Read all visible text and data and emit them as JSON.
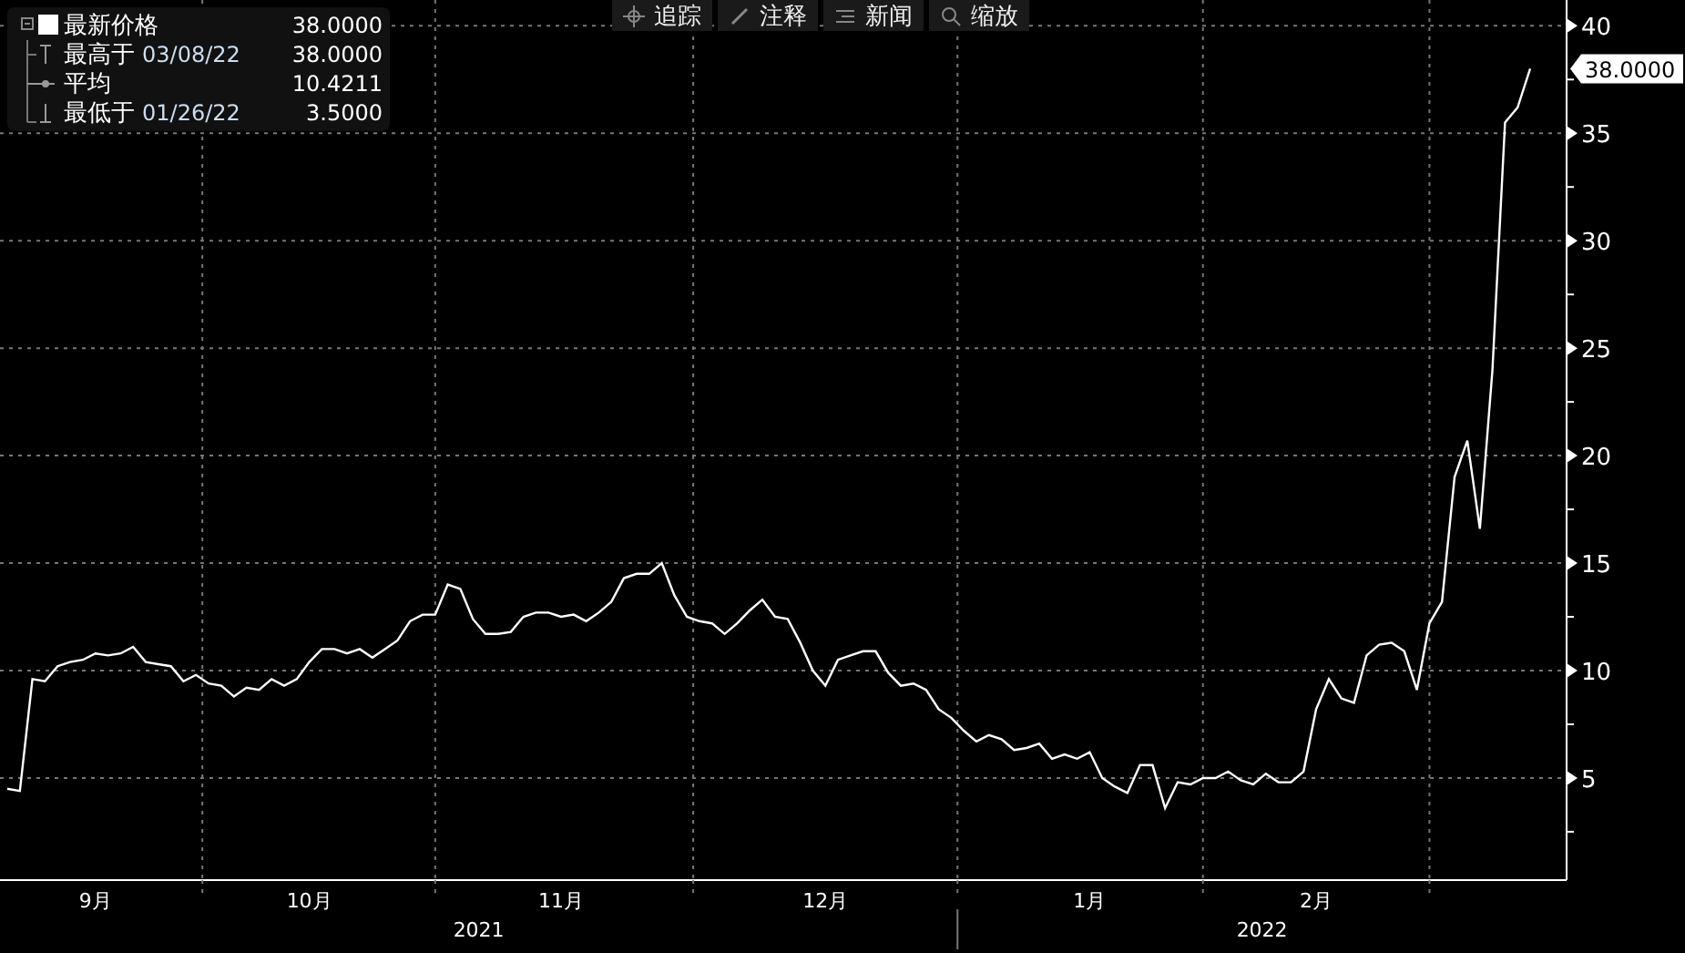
{
  "legend": [
    {
      "kind": "last",
      "value": "38.0000"
    },
    {
      "kind": "high",
      "label": "最高于",
      "date": "03/08/22",
      "value": "38.0000"
    },
    {
      "kind": "average",
      "label": "平均",
      "value": "10.4211"
    },
    {
      "kind": "low",
      "label": "最低于",
      "date": "01/26/22",
      "value": "3.5000"
    }
  ],
  "toolbar": [
    {
      "kind": "track",
      "label": "追踪"
    },
    {
      "kind": "annotate",
      "label": "注释"
    },
    {
      "kind": "news",
      "label": "新闻"
    },
    {
      "kind": "zoom",
      "label": "缩放"
    }
  ],
  "chart": {
    "last_value_label": "38.0000",
    "chart_data": {
      "type": "line",
      "grid": true,
      "ylim": [
        0.25,
        41.2
      ],
      "categories": [
        null,
        null,
        null,
        null,
        null,
        null,
        null,
        "9月",
        null,
        null,
        null,
        null,
        null,
        null,
        null,
        null,
        null,
        null,
        null,
        null,
        null,
        null,
        null,
        null,
        "10月",
        null,
        null,
        null,
        null,
        null,
        null,
        null,
        null,
        null,
        null,
        null,
        null,
        null,
        null,
        null,
        null,
        null,
        null,
        null,
        "11月",
        null,
        null,
        null,
        null,
        null,
        null,
        null,
        null,
        null,
        null,
        null,
        null,
        null,
        null,
        null,
        null,
        null,
        null,
        null,
        null,
        "12月",
        null,
        null,
        null,
        null,
        null,
        null,
        null,
        null,
        null,
        null,
        null,
        null,
        null,
        null,
        null,
        null,
        null,
        null,
        null,
        null,
        "1月",
        null,
        null,
        null,
        null,
        null,
        null,
        null,
        null,
        null,
        null,
        null,
        null,
        null,
        null,
        null,
        null,
        null,
        "2月",
        null,
        null,
        null,
        null,
        null,
        null,
        null,
        null,
        null,
        null,
        null,
        null,
        null,
        null,
        null,
        null,
        null
      ],
      "yticks": [
        5,
        10,
        15,
        20,
        25,
        30,
        35,
        40
      ],
      "series": [
        {
          "name": "最新价格",
          "color": "#ffffff",
          "values": [
            4.5,
            4.4,
            9.6,
            9.5,
            10.2,
            10.4,
            10.5,
            10.8,
            10.7,
            10.8,
            11.1,
            10.4,
            10.3,
            10.2,
            9.5,
            9.8,
            9.4,
            9.3,
            8.8,
            9.2,
            9.1,
            9.6,
            9.3,
            9.6,
            10.4,
            11.0,
            11.0,
            10.8,
            11.0,
            10.6,
            11.0,
            11.4,
            12.3,
            12.6,
            12.6,
            14.0,
            13.8,
            12.4,
            11.7,
            11.7,
            11.8,
            12.5,
            12.7,
            12.7,
            12.5,
            12.6,
            12.3,
            12.7,
            13.2,
            14.3,
            14.5,
            14.5,
            15.0,
            13.5,
            12.5,
            12.3,
            12.2,
            11.7,
            12.2,
            12.8,
            13.3,
            12.5,
            12.4,
            11.3,
            10.0,
            9.3,
            10.5,
            10.7,
            10.9,
            10.9,
            9.9,
            9.3,
            9.4,
            9.1,
            8.2,
            7.8,
            7.2,
            6.7,
            7.0,
            6.8,
            6.3,
            6.4,
            6.6,
            5.9,
            6.1,
            5.9,
            6.2,
            5.0,
            4.6,
            4.3,
            5.6,
            5.6,
            3.6,
            4.8,
            4.7,
            5.0,
            5.0,
            5.3,
            4.9,
            4.7,
            5.2,
            4.8,
            4.8,
            5.3,
            8.2,
            9.6,
            8.7,
            8.5,
            10.7,
            11.2,
            11.3,
            10.9,
            9.1,
            12.2,
            13.2,
            19.0,
            20.7,
            16.6,
            24,
            35.5,
            36.2,
            38.0
          ]
        }
      ]
    },
    "year_labels": [
      {
        "label": "2021"
      },
      {
        "label": "2022"
      }
    ]
  }
}
